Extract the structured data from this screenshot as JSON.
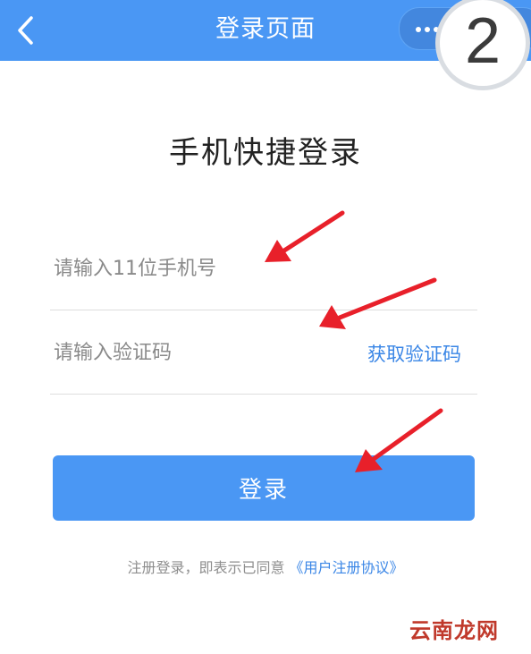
{
  "header": {
    "title": "登录页面",
    "back_icon": "chevron-left-icon",
    "menu_icon": "more-dots-icon",
    "step_badge": "2",
    "bar_color": "#4a97f4"
  },
  "main": {
    "heading": "手机快捷登录",
    "phone_field": {
      "placeholder": "请输入11位手机号",
      "value": ""
    },
    "code_field": {
      "placeholder": "请输入验证码",
      "value": ""
    },
    "get_code_label": "获取验证码",
    "login_label": "登录"
  },
  "footer": {
    "agreement_text": "注册登录，即表示已同意",
    "agreement_link": "《用户注册协议》"
  },
  "watermark": "云南龙网",
  "annotation_color": "#e8202a",
  "link_color": "#3a86e6"
}
